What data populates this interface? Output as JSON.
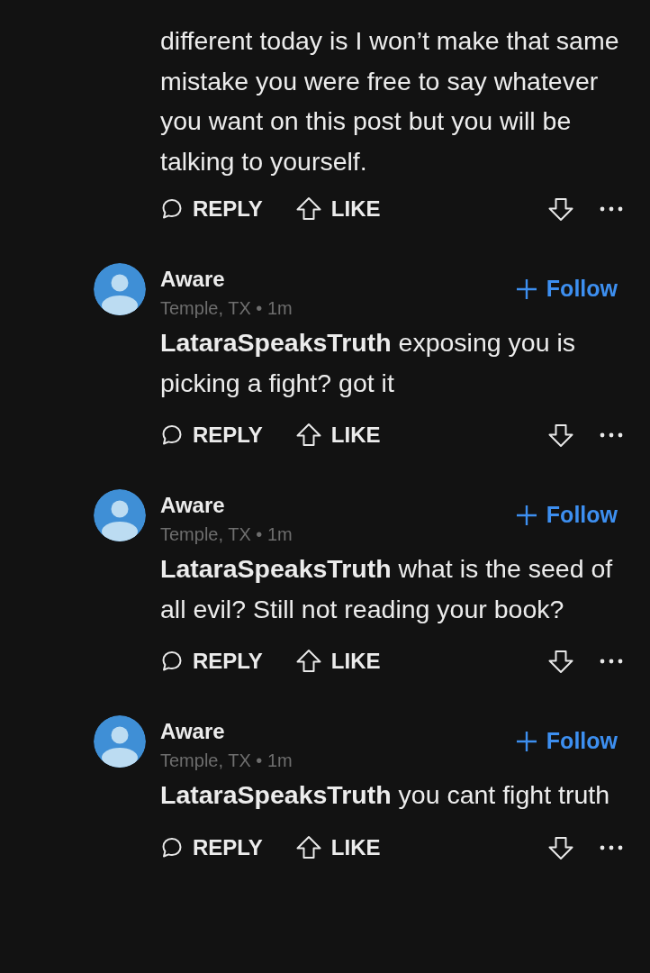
{
  "partial_comment": {
    "body": "different today is I won’t make that same mistake you were free to say whatever you want on this post but you will be talking to yourself.",
    "actions": {
      "reply": "REPLY",
      "like": "LIKE"
    }
  },
  "comments": [
    {
      "author": "Aware",
      "meta": "Temple, TX • 1m",
      "follow": "Follow",
      "body": "**LataraSpeaksTruth** exposing you is picking a fight? got it",
      "actions": {
        "reply": "REPLY",
        "like": "LIKE"
      }
    },
    {
      "author": "Aware",
      "meta": "Temple, TX • 1m",
      "follow": "Follow",
      "body": "**LataraSpeaksTruth** what is the seed of all evil? Still not reading your book?",
      "actions": {
        "reply": "REPLY",
        "like": "LIKE"
      }
    },
    {
      "author": "Aware",
      "meta": "Temple, TX • 1m",
      "follow": "Follow",
      "body": "**LataraSpeaksTruth** you cant fight truth",
      "actions": {
        "reply": "REPLY",
        "like": "LIKE"
      }
    }
  ]
}
